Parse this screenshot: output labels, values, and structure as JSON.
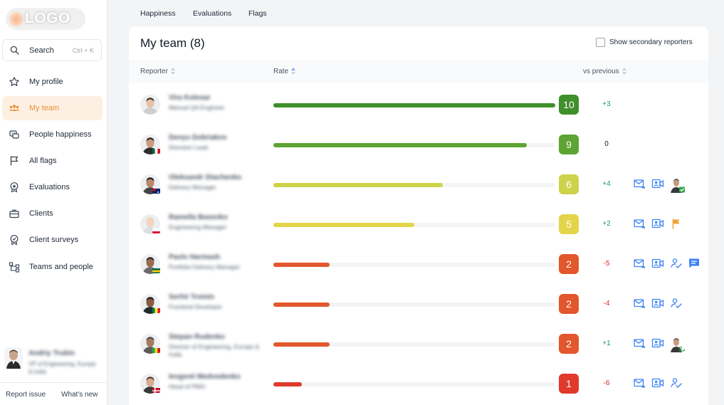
{
  "logo": {
    "text": "LOGO"
  },
  "search": {
    "label": "Search",
    "shortcut": "Ctrl + K"
  },
  "nav": [
    {
      "label": "My profile",
      "icon": "star-icon",
      "active": false
    },
    {
      "label": "My team",
      "icon": "team-icon",
      "active": true
    },
    {
      "label": "People happiness",
      "icon": "happiness-icon",
      "active": false
    },
    {
      "label": "All flags",
      "icon": "flag-icon",
      "active": false
    },
    {
      "label": "Evaluations",
      "icon": "evaluation-icon",
      "active": false
    },
    {
      "label": "Clients",
      "icon": "briefcase-icon",
      "active": false
    },
    {
      "label": "Client surveys",
      "icon": "survey-icon",
      "active": false
    },
    {
      "label": "Teams and people",
      "icon": "hierarchy-icon",
      "active": false
    }
  ],
  "current_user": {
    "name": "Andriy Trubin",
    "role": "VP of Engineering, Europe & India"
  },
  "footer": {
    "report": "Report issue",
    "whats_new": "What's new"
  },
  "tabs": [
    "Happiness",
    "Evaluations",
    "Flags"
  ],
  "panel": {
    "title": "My team (8)",
    "toggle_label": "Show secondary reporters",
    "columns": {
      "reporter": "Reporter",
      "rate": "Rate",
      "vs_previous": "vs previous"
    }
  },
  "colors": {
    "accent": "#e88f35",
    "icon_blue": "#3b82f6",
    "positive": "#16a34a",
    "negative": "#dc2626"
  },
  "rows": [
    {
      "name": "Vira Kolosar",
      "role": "Manual QA Engineer",
      "rate": 10,
      "rate_fraction": 1.0,
      "color": "#3f8f2a",
      "delta": "+3",
      "trend": "up",
      "flag": "",
      "actions": []
    },
    {
      "name": "Denys Dobriakov",
      "role": "Direction Lead",
      "rate": 9,
      "rate_fraction": 0.9,
      "color": "#5da433",
      "delta": "0",
      "trend": "flat",
      "flag": "mx",
      "actions": []
    },
    {
      "name": "Oleksandr Diachenko",
      "role": "Delivery Manager",
      "rate": 6,
      "rate_fraction": 0.6,
      "color": "#cdd24a",
      "delta": "+4",
      "trend": "up",
      "flag": "au",
      "actions": [
        "mail-icon",
        "video-call-icon",
        "reviewer-avatar-checked"
      ]
    },
    {
      "name": "Ramella Basenko",
      "role": "Engineering Manager",
      "rate": 5,
      "rate_fraction": 0.5,
      "color": "#e3d54a",
      "delta": "+2",
      "trend": "up",
      "flag": "pl",
      "actions": [
        "mail-icon",
        "video-call-icon",
        "flag-orange-icon"
      ]
    },
    {
      "name": "Pavlo Harmash",
      "role": "Portfolio Delivery Manager",
      "rate": 2,
      "rate_fraction": 0.2,
      "color": "#e2572c",
      "delta": "-5",
      "trend": "down",
      "flag": "tg",
      "actions": [
        "mail-icon",
        "video-call-icon",
        "assign-icon",
        "comment-icon"
      ]
    },
    {
      "name": "Serhii Troinin",
      "role": "Frontend Developer",
      "rate": 2,
      "rate_fraction": 0.2,
      "color": "#e2572c",
      "delta": "-4",
      "trend": "down",
      "flag": "sn",
      "actions": [
        "mail-icon",
        "video-call-icon",
        "assign-icon"
      ]
    },
    {
      "name": "Stepan Rudenko",
      "role": "Director of Engineering, Europe & India",
      "rate": 2,
      "rate_fraction": 0.2,
      "color": "#e2572c",
      "delta": "+1",
      "trend": "up",
      "flag": "ml",
      "actions": [
        "mail-icon",
        "video-call-icon",
        "reviewer-avatar-list"
      ]
    },
    {
      "name": "Ievgenii Medvedenko",
      "role": "Head of PMO",
      "rate": 1,
      "rate_fraction": 0.1,
      "color": "#df3a2b",
      "delta": "-6",
      "trend": "down",
      "flag": "dk",
      "actions": [
        "mail-icon",
        "video-call-icon",
        "assign-icon"
      ]
    }
  ]
}
